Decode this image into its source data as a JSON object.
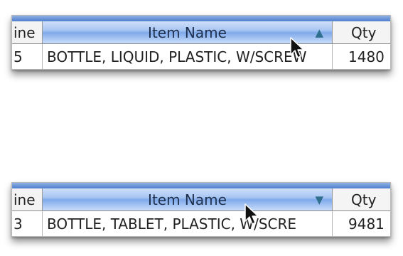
{
  "tables": [
    {
      "headers": {
        "line": "ine",
        "name": "Item Name",
        "qty": "Qty"
      },
      "sort_indicator": "▲",
      "sort_icon": "sort-ascending-icon",
      "row": {
        "line": "5",
        "name": "BOTTLE, LIQUID, PLASTIC, W/SCREW",
        "qty": "1480"
      }
    },
    {
      "headers": {
        "line": "ine",
        "name": "Item Name",
        "qty": "Qty"
      },
      "sort_indicator": "▼",
      "sort_icon": "sort-descending-icon",
      "row": {
        "line": "3",
        "name": "BOTTLE, TABLET, PLASTIC, W/SCRE",
        "qty": "9481"
      }
    }
  ],
  "colors": {
    "header_accent": "#8fb0e2",
    "selected_header": "#7fa9ea",
    "sort_arrow": "#2f6e8c"
  }
}
